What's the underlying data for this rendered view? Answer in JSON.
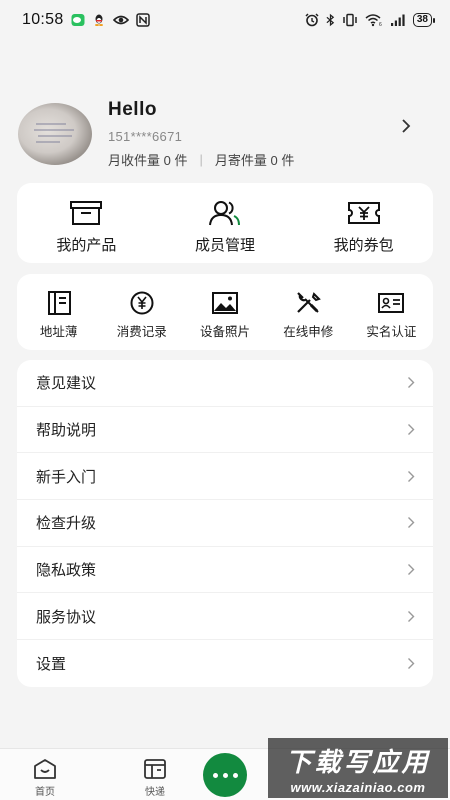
{
  "status_bar": {
    "time": "10:58",
    "battery": "38",
    "left_icons": [
      "wechat-icon",
      "qq-icon",
      "eye-icon",
      "nfc-icon"
    ],
    "right_icons": [
      "alarm-icon",
      "bluetooth-icon",
      "vibrate-icon",
      "wifi-icon",
      "signal-icon",
      "battery-icon"
    ]
  },
  "profile": {
    "name": "Hello",
    "phone": "151****6671",
    "received_label": "月收件量 0 件",
    "sent_label": "月寄件量 0 件",
    "separator": "|"
  },
  "main_menu": [
    {
      "label": "我的产品",
      "icon": "product-box-icon"
    },
    {
      "label": "成员管理",
      "icon": "members-icon"
    },
    {
      "label": "我的券包",
      "icon": "coupon-icon"
    }
  ],
  "tools": [
    {
      "label": "地址薄",
      "icon": "address-book-icon"
    },
    {
      "label": "消费记录",
      "icon": "yuan-coin-icon"
    },
    {
      "label": "设备照片",
      "icon": "image-icon"
    },
    {
      "label": "在线申修",
      "icon": "repair-tools-icon"
    },
    {
      "label": "实名认证",
      "icon": "id-card-icon"
    }
  ],
  "settings_list": [
    {
      "label": "意见建议"
    },
    {
      "label": "帮助说明"
    },
    {
      "label": "新手入门"
    },
    {
      "label": "检查升级"
    },
    {
      "label": "隐私政策"
    },
    {
      "label": "服务协议"
    },
    {
      "label": "设置"
    }
  ],
  "tab_bar": {
    "home_label": "首页",
    "express_label": "快递",
    "accent_color": "#128a3f"
  },
  "watermark": {
    "title": "下载写应用",
    "url": "www.xiazainiao.com"
  }
}
